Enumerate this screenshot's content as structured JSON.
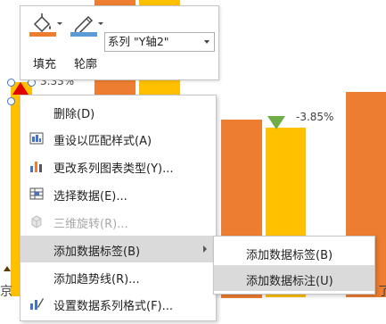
{
  "chart": {
    "label_left": "3.33%",
    "label_right": "-3.85%",
    "axis_fragment_left": "京",
    "axis_fragment_right": "了",
    "colors": {
      "series_orange": "#ED7D31",
      "series_yellow": "#FFC000",
      "marker_up": "#E00000",
      "marker_down": "#70AD47"
    }
  },
  "mini_toolbar": {
    "fill_label": "填充",
    "outline_label": "轮廓",
    "series_select_value": "系列 \"Y轴2\"",
    "icons": {
      "fill": "paint-bucket-icon",
      "outline": "pen-outline-icon"
    },
    "colors": {
      "fill_swatch": "#ED7D31",
      "outline_swatch": "#5B9BD5"
    }
  },
  "context_menu": {
    "items": [
      {
        "label": "删除(D)",
        "icon": "delete-icon",
        "enabled": true
      },
      {
        "label": "重设以匹配样式(A)",
        "icon": "reset-style-icon",
        "enabled": true
      },
      {
        "label": "更改系列图表类型(Y)...",
        "icon": "chart-type-icon",
        "enabled": true
      },
      {
        "label": "选择数据(E)...",
        "icon": "select-data-icon",
        "enabled": true
      },
      {
        "label": "三维旋转(R)...",
        "icon": "rotate-3d-icon",
        "enabled": false
      },
      {
        "label": "添加数据标签(B)",
        "icon": "",
        "enabled": true,
        "has_submenu": true,
        "highlighted": true
      },
      {
        "label": "添加趋势线(R)...",
        "icon": "",
        "enabled": true
      },
      {
        "label": "设置数据系列格式(F)...",
        "icon": "format-series-icon",
        "enabled": true
      }
    ]
  },
  "submenu": {
    "items": [
      {
        "label": "添加数据标签(B)"
      },
      {
        "label": "添加数据标注(U)",
        "highlighted": true
      }
    ]
  }
}
